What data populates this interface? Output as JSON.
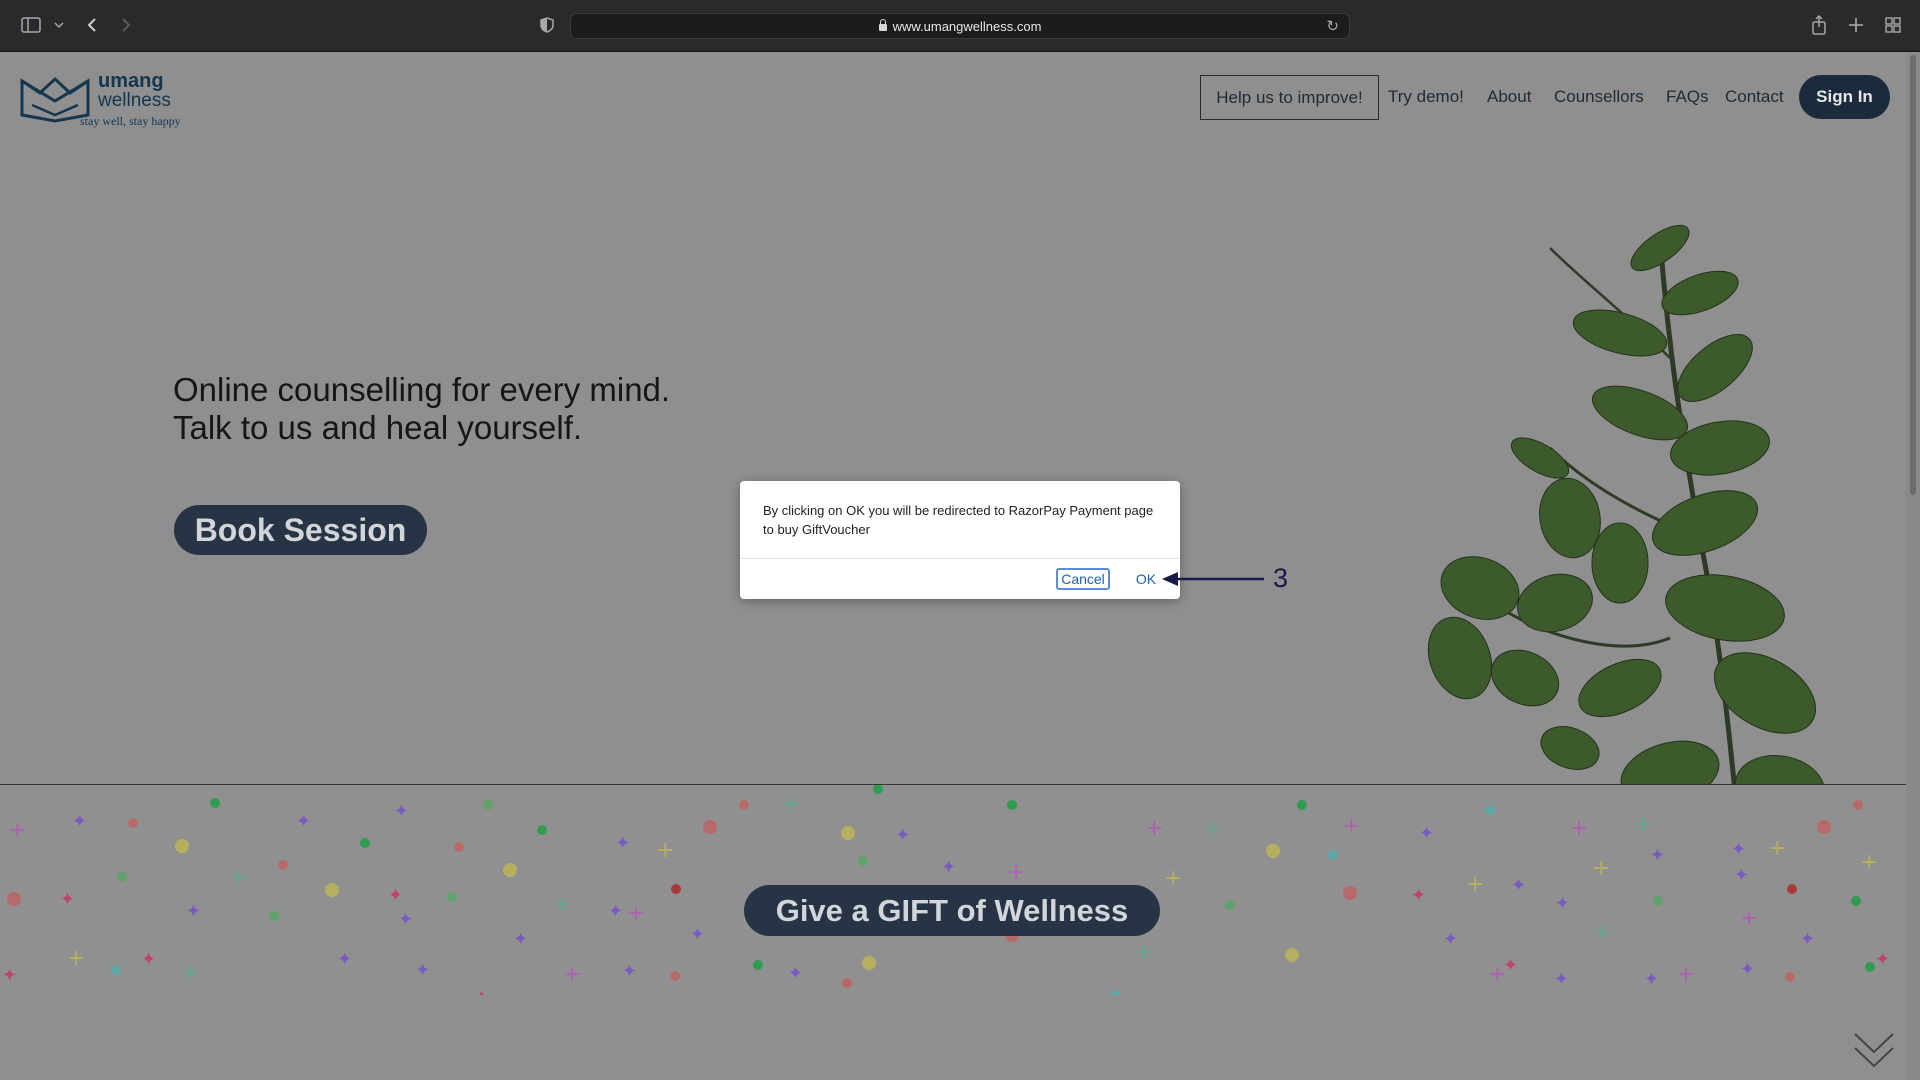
{
  "browser": {
    "url": "www.umangwellness.com",
    "icons": [
      "sidebar-icon",
      "chevron-down-icon",
      "back-icon",
      "forward-icon",
      "shield-icon",
      "lock-icon",
      "reload-icon",
      "share-icon",
      "new-tab-icon",
      "tab-overview-icon"
    ]
  },
  "header": {
    "logo": {
      "brand_line1": "umang",
      "brand_line2": "wellness",
      "tagline": "stay well, stay happy"
    },
    "nav": {
      "improve": "Help us to improve!",
      "demo": "Try demo!",
      "about": "About",
      "counsellors": "Counsellors",
      "faqs": "FAQs",
      "contact": "Contact",
      "signin": "Sign In"
    }
  },
  "hero": {
    "line1": "Online counselling for every mind.",
    "line2": "Talk to us and heal yourself.",
    "cta": "Book Session"
  },
  "gift": {
    "cta": "Give a GIFT of Wellness"
  },
  "dialog": {
    "message": "By clicking on OK you will be redirected to RazorPay Payment page to buy GiftVoucher",
    "cancel": "Cancel",
    "ok": "OK"
  },
  "annotation": {
    "label": "3"
  },
  "colors": {
    "navy": "#1c2b3c",
    "overlay": "#8f8f8f",
    "link_blue": "#1f5fbf"
  }
}
